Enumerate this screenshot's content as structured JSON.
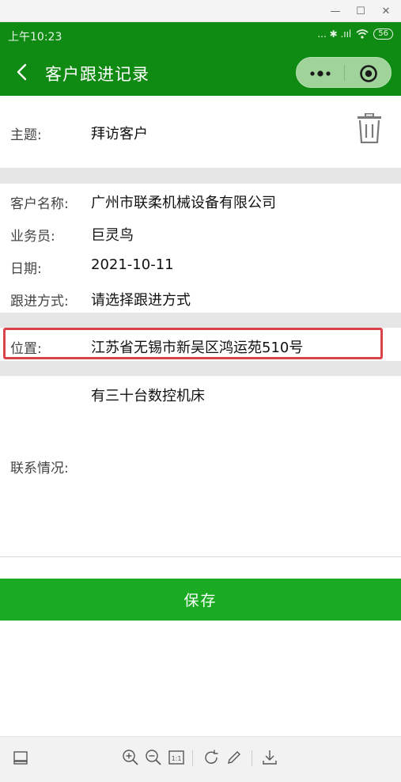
{
  "window": {
    "minimize_glyph": "—",
    "maximize_glyph": "☐",
    "close_glyph": "✕"
  },
  "status_bar": {
    "time": "上午10:23",
    "signal_text": "... ✱ .ııl",
    "battery": "56"
  },
  "nav": {
    "title": "客户跟进记录"
  },
  "form": {
    "subject_label": "主题:",
    "subject_value": "拜访客户",
    "customer_label": "客户名称:",
    "customer_value": "广州市联柔机械设备有限公司",
    "salesperson_label": "业务员:",
    "salesperson_value": "巨灵鸟",
    "date_label": "日期:",
    "date_value": "2021-10-11",
    "method_label": "跟进方式:",
    "method_value": "请选择跟进方式",
    "location_label": "位置:",
    "location_value": "江苏省无锡市新吴区鸿运苑510号",
    "contact_label": "联系情况:",
    "contact_value": "有三十台数控机床"
  },
  "actions": {
    "save_label": "保存"
  },
  "colors": {
    "header_green": "#0f8a12",
    "save_green": "#1aab23",
    "highlight_red": "#d9434a"
  }
}
